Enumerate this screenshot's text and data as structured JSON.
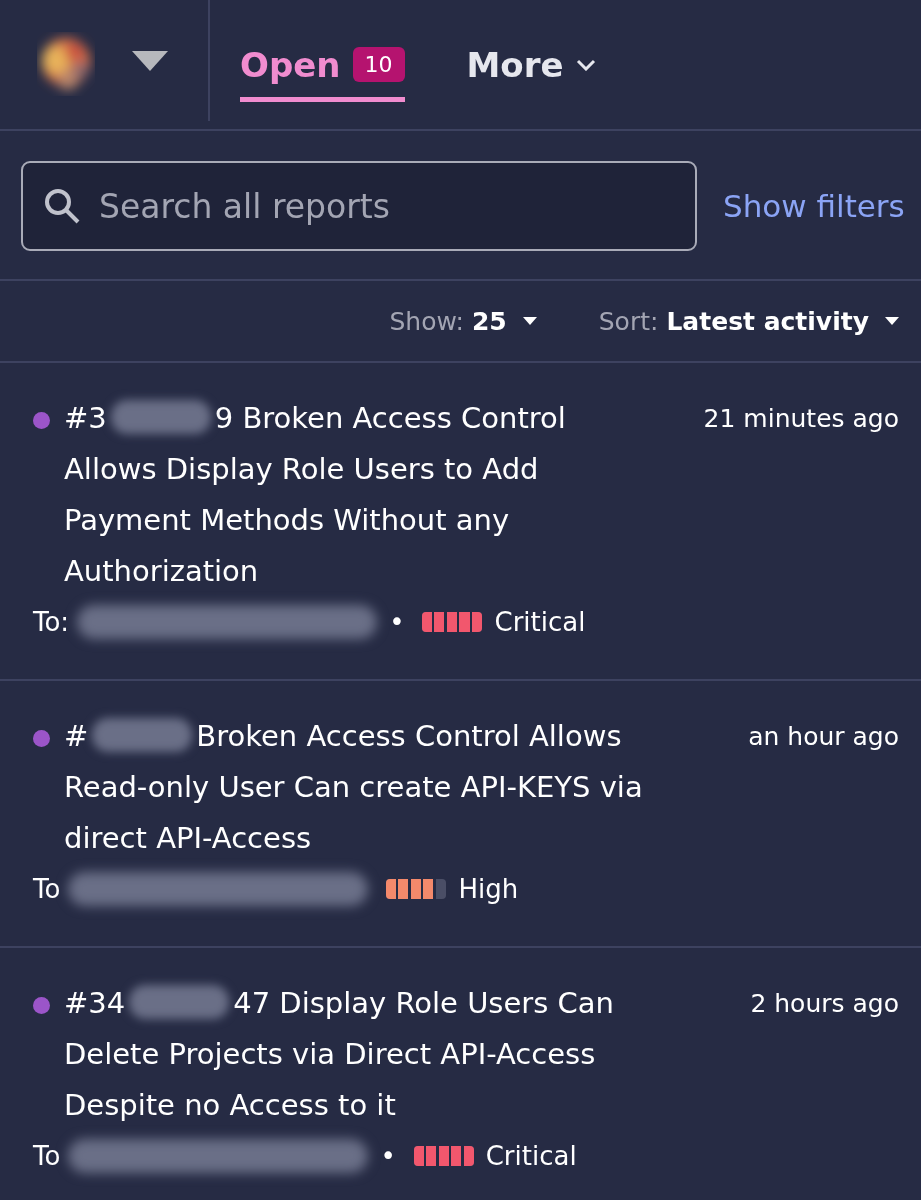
{
  "header": {
    "tabs": [
      {
        "label": "Open",
        "count": "10",
        "selected": true,
        "kind": "tab"
      },
      {
        "label": "More",
        "selected": false,
        "kind": "menu"
      }
    ]
  },
  "search": {
    "placeholder": "Search all reports"
  },
  "show_filters": "Show filters",
  "list_controls": {
    "show": {
      "label": "Show:",
      "value": "25"
    },
    "sort": {
      "label": "Sort:",
      "value": "Latest activity"
    }
  },
  "reports": [
    {
      "color": "#9b55c9",
      "id": "#3",
      "title": "9 Broken Access Control Allows Display Role Users to Add Payment Methods Without any Authorization",
      "time": "21 minutes ago",
      "recipient": "To:",
      "separator": "•",
      "severity": {
        "label": "Critical",
        "level": 1,
        "color": "#f2576d"
      }
    },
    {
      "color": "#9b55c9",
      "id": "#",
      "title": "Broken Access Control Allows Read-only User Can create API-KEYS via direct API-Access",
      "time": "an hour ago",
      "recipient": "To",
      "severity": {
        "label": "High",
        "level": 0.8,
        "color": "#f4896b"
      }
    },
    {
      "color": "#9b55c9",
      "id": "#34",
      "title": "47 Display Role Users Can Delete Projects via Direct API-Access Despite no Access to it",
      "time": "2 hours ago",
      "recipient": "To",
      "separator": "•",
      "severity": {
        "label": "Critical",
        "level": 1,
        "color": "#f2576d"
      }
    }
  ]
}
